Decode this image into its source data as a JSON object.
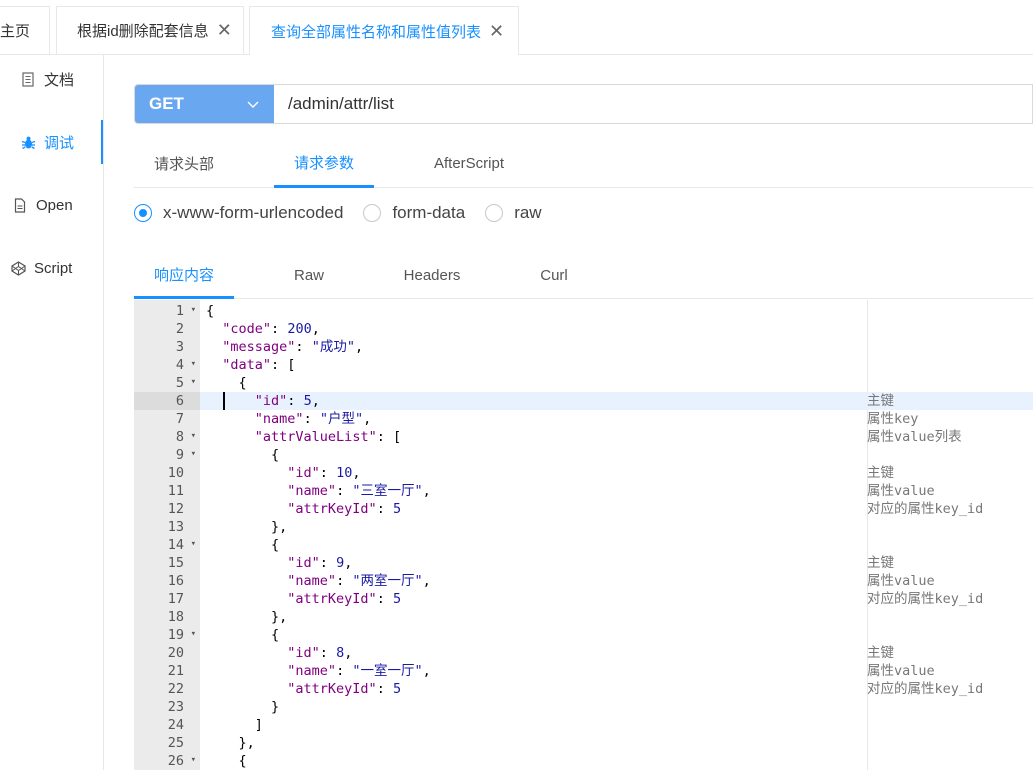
{
  "tabs": [
    {
      "label": "主页",
      "closable": false,
      "active": false
    },
    {
      "label": "根据id删除配套信息",
      "closable": true,
      "active": false
    },
    {
      "label": "查询全部属性名称和属性值列表",
      "closable": true,
      "active": true
    }
  ],
  "close_glyph": "✕",
  "sidebar": [
    {
      "label": "文档",
      "icon": "document-icon",
      "active": false
    },
    {
      "label": "调试",
      "icon": "bug-icon",
      "active": true
    },
    {
      "label": "Open",
      "icon": "file-icon",
      "active": false
    },
    {
      "label": "Script",
      "icon": "codepen-icon",
      "active": false
    }
  ],
  "request": {
    "method": "GET",
    "url": "/admin/attr/list"
  },
  "request_tabs": [
    {
      "label": "请求头部",
      "active": false
    },
    {
      "label": "请求参数",
      "active": true
    },
    {
      "label": "AfterScript",
      "active": false
    }
  ],
  "body_types": [
    {
      "label": "x-www-form-urlencoded",
      "checked": true
    },
    {
      "label": "form-data",
      "checked": false
    },
    {
      "label": "raw",
      "checked": false
    }
  ],
  "response_tabs": [
    {
      "label": "响应内容",
      "active": true
    },
    {
      "label": "Raw",
      "active": false
    },
    {
      "label": "Headers",
      "active": false
    },
    {
      "label": "Curl",
      "active": false
    }
  ],
  "colors": {
    "accent": "#1890ff",
    "method_bg": "#69a8f0"
  },
  "code_lines": [
    {
      "n": "1",
      "fold": true,
      "text": "{",
      "comment": ""
    },
    {
      "n": "2",
      "fold": false,
      "text": "  \"code\": 200,",
      "comment": ""
    },
    {
      "n": "3",
      "fold": false,
      "text": "  \"message\": \"成功\",",
      "comment": ""
    },
    {
      "n": "4",
      "fold": true,
      "text": "  \"data\": [",
      "comment": ""
    },
    {
      "n": "5",
      "fold": true,
      "text": "    {",
      "comment": ""
    },
    {
      "n": "6",
      "fold": false,
      "text": "      \"id\": 5,",
      "comment": "主键",
      "highlight": true
    },
    {
      "n": "7",
      "fold": false,
      "text": "      \"name\": \"户型\",",
      "comment": "属性key"
    },
    {
      "n": "8",
      "fold": true,
      "text": "      \"attrValueList\": [",
      "comment": "属性value列表"
    },
    {
      "n": "9",
      "fold": true,
      "text": "        {",
      "comment": ""
    },
    {
      "n": "10",
      "fold": false,
      "text": "          \"id\": 10,",
      "comment": "主键"
    },
    {
      "n": "11",
      "fold": false,
      "text": "          \"name\": \"三室一厅\",",
      "comment": "属性value"
    },
    {
      "n": "12",
      "fold": false,
      "text": "          \"attrKeyId\": 5",
      "comment": "对应的属性key_id"
    },
    {
      "n": "13",
      "fold": false,
      "text": "        },",
      "comment": ""
    },
    {
      "n": "14",
      "fold": true,
      "text": "        {",
      "comment": ""
    },
    {
      "n": "15",
      "fold": false,
      "text": "          \"id\": 9,",
      "comment": "主键"
    },
    {
      "n": "16",
      "fold": false,
      "text": "          \"name\": \"两室一厅\",",
      "comment": "属性value"
    },
    {
      "n": "17",
      "fold": false,
      "text": "          \"attrKeyId\": 5",
      "comment": "对应的属性key_id"
    },
    {
      "n": "18",
      "fold": false,
      "text": "        },",
      "comment": ""
    },
    {
      "n": "19",
      "fold": true,
      "text": "        {",
      "comment": ""
    },
    {
      "n": "20",
      "fold": false,
      "text": "          \"id\": 8,",
      "comment": "主键"
    },
    {
      "n": "21",
      "fold": false,
      "text": "          \"name\": \"一室一厅\",",
      "comment": "属性value"
    },
    {
      "n": "22",
      "fold": false,
      "text": "          \"attrKeyId\": 5",
      "comment": "对应的属性key_id"
    },
    {
      "n": "23",
      "fold": false,
      "text": "        }",
      "comment": ""
    },
    {
      "n": "24",
      "fold": false,
      "text": "      ]",
      "comment": ""
    },
    {
      "n": "25",
      "fold": false,
      "text": "    },",
      "comment": ""
    },
    {
      "n": "26",
      "fold": true,
      "text": "    {",
      "comment": ""
    }
  ]
}
